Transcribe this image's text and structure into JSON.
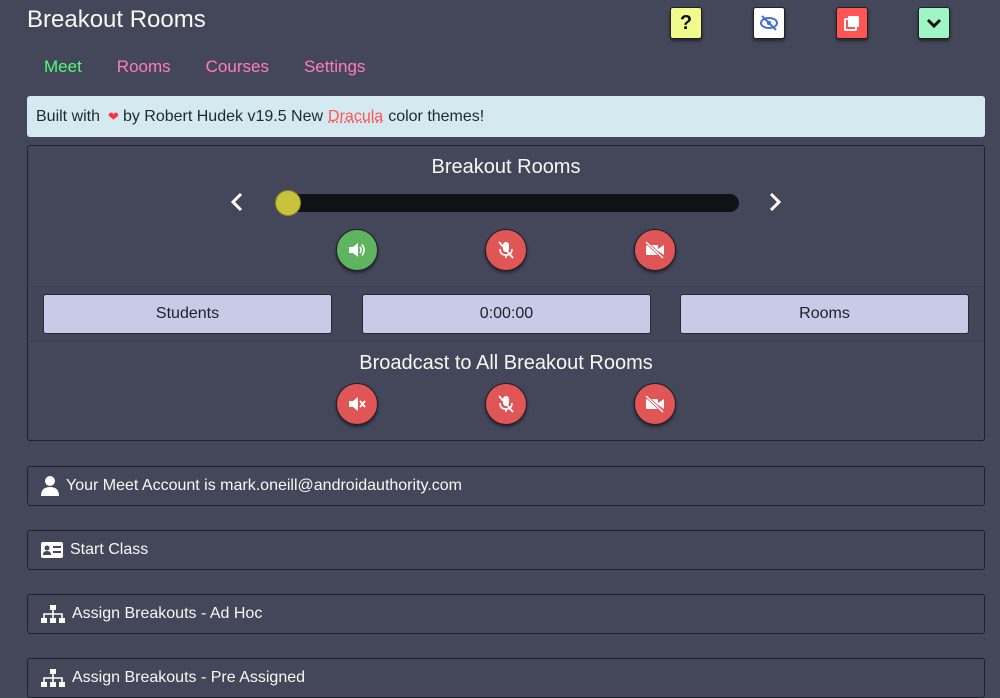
{
  "app": {
    "title": "Breakout Rooms"
  },
  "toolbar": {
    "help_label": "?"
  },
  "nav": {
    "meet": "Meet",
    "rooms": "Rooms",
    "courses": "Courses",
    "settings": "Settings"
  },
  "banner": {
    "prefix": "Built with",
    "suffix": "by Robert Hudek v19.5 New",
    "link": "Dracula",
    "end": "color themes!"
  },
  "panel": {
    "title": "Breakout Rooms",
    "slider_fraction": 0.0,
    "students_label": "Students",
    "timer": "0:00:00",
    "rooms_label": "Rooms",
    "broadcast_title": "Broadcast to All Breakout Rooms"
  },
  "sections": {
    "account": "Your Meet Account is mark.oneill@androidauthority.com",
    "start_class": "Start Class",
    "assign_adhoc": "Assign Breakouts - Ad Hoc",
    "assign_pre": "Assign Breakouts - Pre Assigned"
  },
  "colors": {
    "background": "#44475a",
    "nav_active": "#50fa7b",
    "nav_inactive": "#ff79c6",
    "slider_thumb": "#c7c33c"
  },
  "icons": {
    "help": "question-icon",
    "hide": "eye-slash-icon",
    "popout": "window-restore-icon",
    "collapse": "chevron-down-icon",
    "speaker": "volume-up-icon",
    "mic_off": "microphone-slash-icon",
    "video_off": "video-slash-icon",
    "mute": "volume-mute-icon"
  }
}
